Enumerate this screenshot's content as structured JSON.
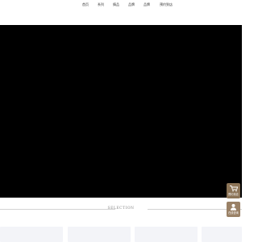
{
  "nav": {
    "items": [
      "首页",
      "系列",
      "情品",
      "品牌",
      "品牌",
      "预约到店"
    ]
  },
  "section": {
    "title": "SELECTION"
  },
  "floating": {
    "cart": {
      "label": "预约到店",
      "color": "#8c7457"
    },
    "user": {
      "label": "在线咨询",
      "color": "#9a8166"
    }
  }
}
